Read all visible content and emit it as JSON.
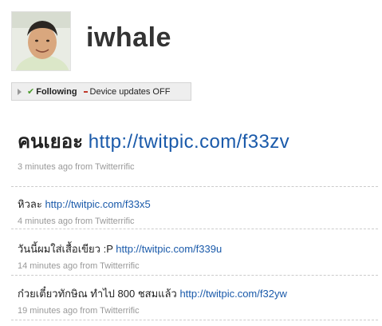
{
  "profile": {
    "username": "iwhale"
  },
  "status_bar": {
    "following_label": "Following",
    "device_updates_label": "Device updates OFF"
  },
  "latest_tweet": {
    "text": "คนเยอะ",
    "link": "http://twitpic.com/f33zv",
    "meta": "3 minutes ago from Twitterrific"
  },
  "tweets": [
    {
      "text": "หิวละ",
      "link": "http://twitpic.com/f33x5",
      "meta": "4 minutes ago from Twitterrific"
    },
    {
      "text": "วันนี้ผมใส่เสื้อเขียว :P",
      "link": "http://twitpic.com/f339u",
      "meta": "14 minutes ago from Twitterrific"
    },
    {
      "text": "ก๋วยเตี๋ยวทักษิณ ทำไป 800 ชสมแล้ว",
      "link": "http://twitpic.com/f32yw",
      "meta": "19 minutes ago from Twitterrific"
    }
  ],
  "colors": {
    "link": "#1a5aaa",
    "meta": "#999999",
    "following_check": "#4a9a2a",
    "device_minus": "#c0392b"
  }
}
